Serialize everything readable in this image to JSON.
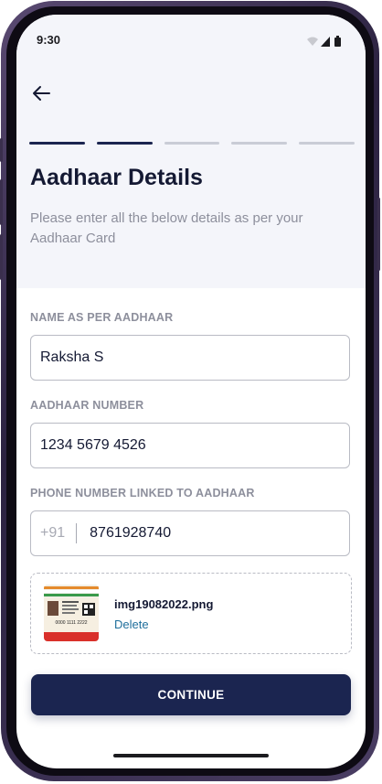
{
  "status_bar": {
    "time": "9:30"
  },
  "header": {
    "title": "Aadhaar Details",
    "subtitle": "Please enter all the below details as per your Aadhaar Card",
    "steps": [
      {
        "active": true
      },
      {
        "active": true
      },
      {
        "active": false
      },
      {
        "active": false
      },
      {
        "active": false
      }
    ]
  },
  "form": {
    "name": {
      "label": "NAME AS PER AADHAAR",
      "value": "Raksha S"
    },
    "aadhaar_number": {
      "label": "AADHAAR NUMBER",
      "value": "1234 5679 4526"
    },
    "phone": {
      "label": "PHONE NUMBER LINKED TO AADHAAR",
      "prefix": "+91",
      "value": "8761928740"
    }
  },
  "upload": {
    "file_name": "img19082022.png",
    "delete_label": "Delete",
    "card_number_text": "0000 1111 2222"
  },
  "continue_label": "CONTINUE",
  "colors": {
    "primary": "#1b2550",
    "link": "#1f6f9c",
    "panel_bg": "#f4f5fa"
  }
}
